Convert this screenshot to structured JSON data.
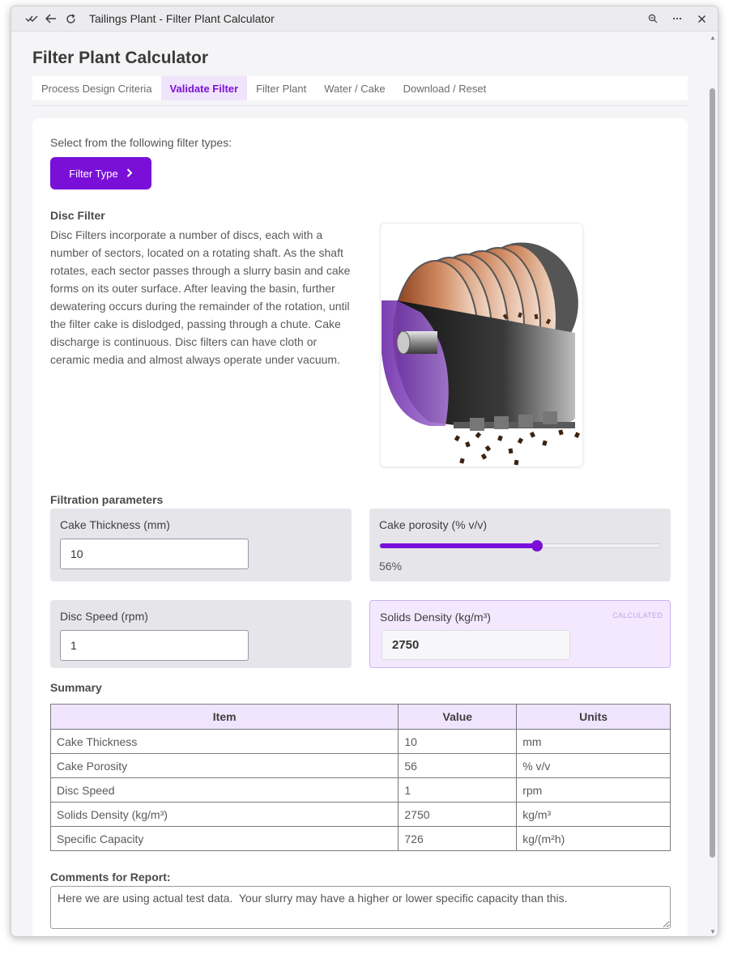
{
  "window": {
    "title": "Tailings Plant - Filter Plant Calculator",
    "icons": [
      "checkmarks-icon",
      "back-arrow-icon",
      "reload-icon",
      "zoom-icon",
      "more-icon",
      "close-icon"
    ]
  },
  "page": {
    "title": "Filter Plant Calculator"
  },
  "tabs": [
    {
      "label": "Process Design Criteria",
      "active": false
    },
    {
      "label": "Validate Filter",
      "active": true
    },
    {
      "label": "Filter Plant",
      "active": false
    },
    {
      "label": "Water / Cake",
      "active": false
    },
    {
      "label": "Download / Reset",
      "active": false
    }
  ],
  "filter_select": {
    "prompt": "Select from the following filter types:",
    "button_label": "Filter Type",
    "button_icon": "chevron-right-icon"
  },
  "filter": {
    "name": "Disc Filter",
    "description": "Disc Filters incorporate a number of discs, each with a number of sectors, located on a rotating shaft. As the shaft rotates, each sector passes through a slurry basin and cake forms on its outer surface. After leaving the basin, further dewatering occurs during the remainder of the rotation, until the filter cake is dislodged, passing through a chute. Cake discharge is continuous. Disc filters can have cloth or ceramic media and almost always operate under vacuum."
  },
  "params": {
    "section_label": "Filtration parameters",
    "cake_thickness": {
      "label": "Cake Thickness (mm)",
      "value": "10"
    },
    "cake_porosity": {
      "label": "Cake porosity (% v/v)",
      "value": 56,
      "display": "56%",
      "min": 0,
      "max": 100
    },
    "disc_speed": {
      "label": "Disc Speed (rpm)",
      "value": "1"
    },
    "solids_density": {
      "label": "Solids Density (kg/m³)",
      "value": "2750",
      "tag": "CALCULATED"
    }
  },
  "summary": {
    "label": "Summary",
    "headers": [
      "Item",
      "Value",
      "Units"
    ],
    "rows": [
      [
        "Cake Thickness",
        "10",
        "mm"
      ],
      [
        "Cake Porosity",
        "56",
        "% v/v"
      ],
      [
        "Disc Speed",
        "1",
        "rpm"
      ],
      [
        "Solids Density (kg/m³)",
        "2750",
        "kg/m³"
      ],
      [
        "Specific Capacity",
        "726",
        "kg/(m²h)"
      ]
    ]
  },
  "comments": {
    "label": "Comments for Report:",
    "value": "Here we are using actual test data.  Your slurry may have a higher or lower specific capacity than this."
  },
  "colors": {
    "accent": "#7a10d8",
    "accent_light": "#f1e5fd"
  }
}
